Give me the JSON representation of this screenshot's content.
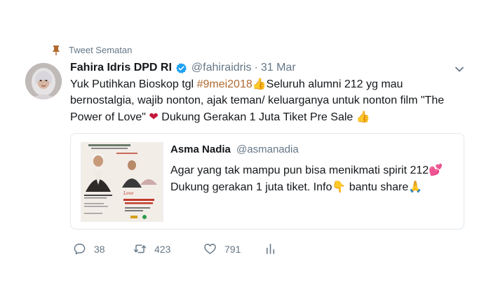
{
  "pinned": {
    "label": "Tweet Sematan"
  },
  "tweet": {
    "display_name": "Fahira Idris DPD RI",
    "handle": "@fahiraidris",
    "separator": "·",
    "date": "31 Mar",
    "text": {
      "part1": "Yuk Putihkan Bioskop tgl ",
      "hashtag": "#9mei2018",
      "emoji1": "👍",
      "part2": "Seluruh alumni 212 yg mau bernostalgia,  wajib nonton, ajak teman/ keluarganya untuk nonton film \"The Power of Love\" ",
      "emoji2": "❤",
      "part3": " Dukung Gerakan 1 Juta Tiket Pre Sale ",
      "emoji3": "👍"
    }
  },
  "quoted": {
    "name": "Asma Nadia",
    "handle": "@asmanadia",
    "line1": "Agar yang tak mampu pun bisa menikmati spirit 212",
    "emoji1": "💕",
    "line2a": "Dukung gerakan 1 juta tiket. Info",
    "emoji2": "👇",
    "line2b": " bantu share",
    "emoji3": "🙏"
  },
  "actions": {
    "replies": "38",
    "retweets": "423",
    "likes": "791"
  },
  "colors": {
    "accent": "#1da1f2",
    "hashtag": "#b06a32",
    "muted": "#657786",
    "border": "#e1e8ed"
  },
  "icons": [
    "pin-icon",
    "verified-icon",
    "chevron-down-icon",
    "reply-icon",
    "retweet-icon",
    "like-icon",
    "analytics-icon"
  ]
}
